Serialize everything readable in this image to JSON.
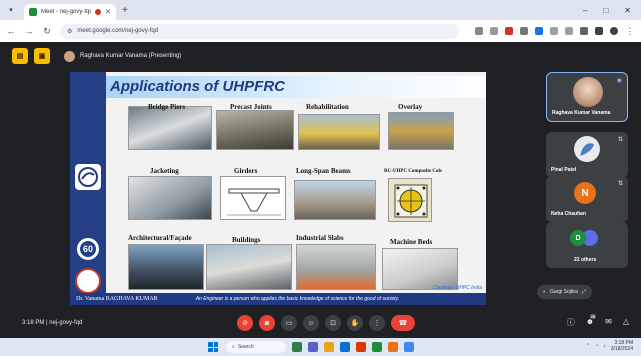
{
  "browser": {
    "tab_title": "Meet - nej-govy-fqd",
    "url": "meet.google.com/nej-govy-fqd",
    "new_tab": "+",
    "window_controls": [
      "‒",
      "□",
      "✕"
    ]
  },
  "presenter": {
    "label": "Raghava Kumar Vanama (Presenting)"
  },
  "slide": {
    "title": "Applications of UHPFRC",
    "author": "Dr. Vanama RAGHAVA KUMAR",
    "quote": "An Engineer is a person who applies the basic knowledge of science for the good of society.",
    "credit": "Courtesy: UHPC India",
    "logo_60": "60",
    "cells": [
      {
        "label": "Bridge Piers"
      },
      {
        "label": "Precast Joints"
      },
      {
        "label": "Rehabilitation"
      },
      {
        "label": "Overlay"
      },
      {
        "label": "Jacketing"
      },
      {
        "label": "Girders"
      },
      {
        "label": "Long-Span Beams"
      },
      {
        "label": "RC-UHPC Composite Cols"
      },
      {
        "label": "Architectural/Façade"
      },
      {
        "label": "Buildings"
      },
      {
        "label": "Industrial Slabs"
      },
      {
        "label": "Machine Beds"
      }
    ]
  },
  "participants": [
    {
      "name": "Raghava Kumar Vanama",
      "initial": ""
    },
    {
      "name": "Pinal Patel",
      "initial": ""
    },
    {
      "name": "Neha Chauhan",
      "initial": "N"
    },
    {
      "name": "22 others",
      "initial": "D"
    }
  ],
  "pinned": {
    "name": "Gargi Sojitra"
  },
  "meeting": {
    "time": "3:18 PM",
    "separator": "|",
    "code": "nej-govy-fqd",
    "people_count": "26"
  },
  "taskbar": {
    "search": "Search",
    "clock_time": "3:18 PM",
    "clock_date": "3/18/2024"
  },
  "colors": {
    "meet_bg": "#202124",
    "slide_blue": "#1f3a82",
    "leave_red": "#ea4335",
    "accent_yellow": "#fbbc04"
  }
}
